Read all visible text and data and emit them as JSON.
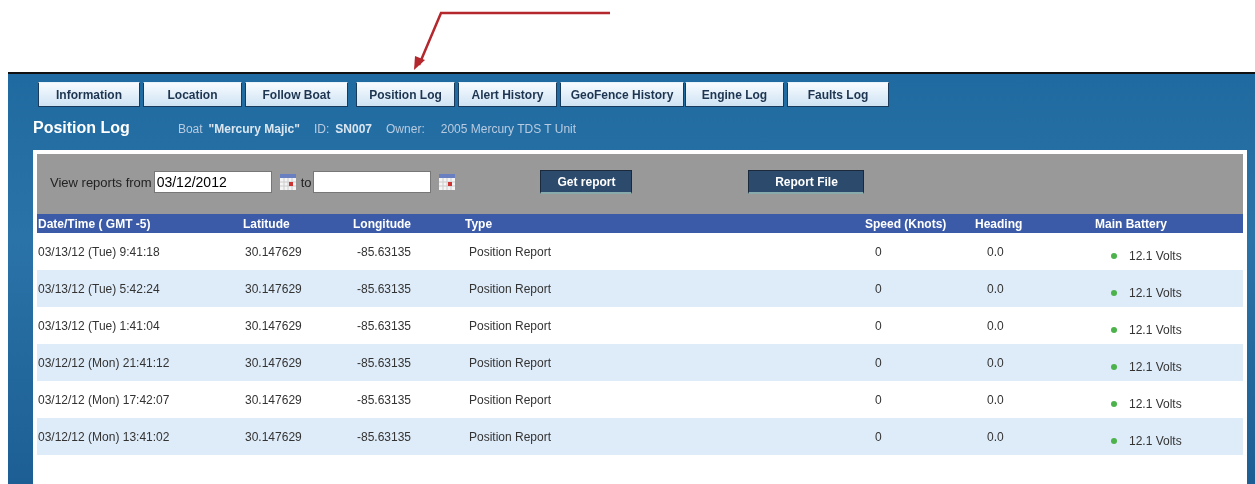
{
  "tabs": [
    {
      "label": "Information"
    },
    {
      "label": "Location"
    },
    {
      "label": "Follow Boat"
    },
    {
      "label": "Position Log"
    },
    {
      "label": "Alert History"
    },
    {
      "label": "GeoFence History"
    },
    {
      "label": "Engine Log"
    },
    {
      "label": "Faults Log"
    }
  ],
  "page_title": "Position Log",
  "boat_info": {
    "boat_label": "Boat",
    "boat_name": "\"Mercury Majic\"",
    "id_label": "ID:",
    "id": "SN007",
    "owner_label": "Owner:",
    "owner": "2005 Mercury  TDS T Unit"
  },
  "filter": {
    "from_label": "View reports from",
    "from_value": "03/12/2012",
    "to_label": "to",
    "get_button": "Get report",
    "file_button": "Report File"
  },
  "table": {
    "columns": [
      "Date/Time ( GMT -5)",
      "Latitude",
      "Longitude",
      "Type",
      "Speed (Knots)",
      "Heading",
      "Main Battery"
    ],
    "rows": [
      {
        "datetime": "03/13/12 (Tue) 9:41:18",
        "latitude": "30.147629",
        "longitude": "-85.63135",
        "type": "Position Report",
        "speed": "0",
        "heading": "0.0",
        "battery": "12.1 Volts",
        "color": "#4cb24c"
      },
      {
        "datetime": "03/13/12 (Tue) 5:42:24",
        "latitude": "30.147629",
        "longitude": "-85.63135",
        "type": "Position Report",
        "speed": "0",
        "heading": "0.0",
        "battery": "12.1 Volts",
        "color": "#4cb24c"
      },
      {
        "datetime": "03/13/12 (Tue) 1:41:04",
        "latitude": "30.147629",
        "longitude": "-85.63135",
        "type": "Position Report",
        "speed": "0",
        "heading": "0.0",
        "battery": "12.1 Volts",
        "color": "#4cb24c"
      },
      {
        "datetime": "03/12/12 (Mon) 21:41:12",
        "latitude": "30.147629",
        "longitude": "-85.63135",
        "type": "Position Report",
        "speed": "0",
        "heading": "0.0",
        "battery": "12.1 Volts",
        "color": "#4cb24c"
      },
      {
        "datetime": "03/12/12 (Mon) 17:42:07",
        "latitude": "30.147629",
        "longitude": "-85.63135",
        "type": "Position Report",
        "speed": "0",
        "heading": "0.0",
        "battery": "12.1 Volts",
        "color": "#4cb24c"
      },
      {
        "datetime": "03/12/12 (Mon) 13:41:02",
        "latitude": "30.147629",
        "longitude": "-85.63135",
        "type": "Position Report",
        "speed": "0",
        "heading": "0.0",
        "battery": "12.1 Volts",
        "color": "#4cb24c"
      }
    ]
  }
}
